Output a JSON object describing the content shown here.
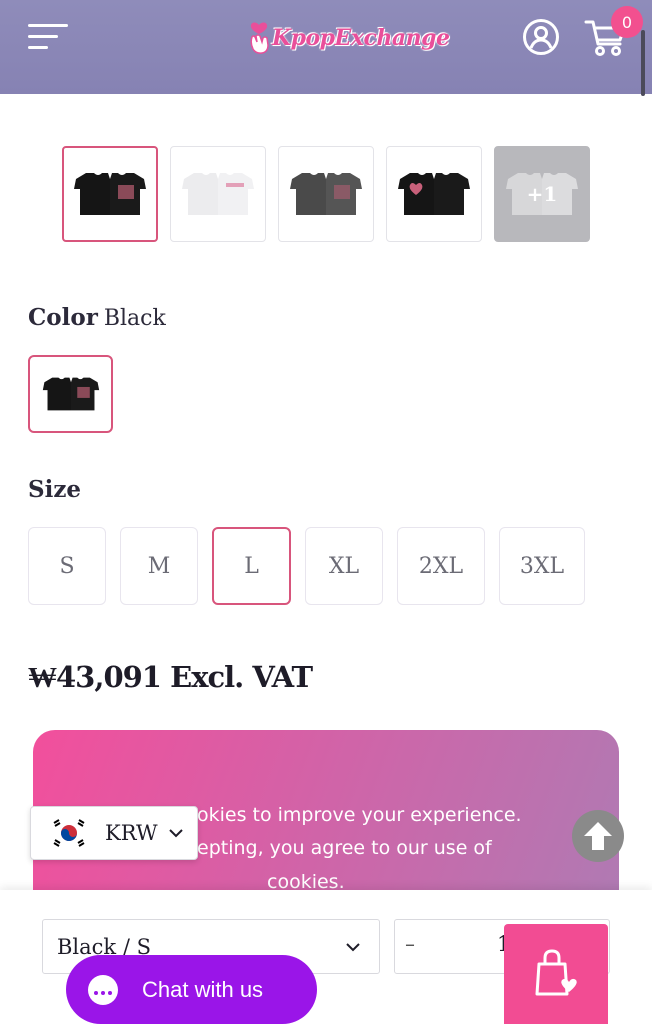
{
  "header": {
    "logo_text": "KpopExchange",
    "cart_count": "0"
  },
  "thumbnails": [
    {
      "name": "black-tee",
      "active": true
    },
    {
      "name": "white-tee",
      "active": false
    },
    {
      "name": "grey-tee",
      "active": false
    },
    {
      "name": "black-heart-tee",
      "active": false
    },
    {
      "name": "more-images",
      "active": false,
      "overlay": "+1"
    }
  ],
  "product": {
    "color_label": "Color",
    "color_value": "Black",
    "size_label": "Size",
    "sizes": [
      "S",
      "M",
      "L",
      "XL",
      "2XL",
      "3XL"
    ],
    "selected_size": "L",
    "price": "₩43,091 Excl. VAT"
  },
  "cookie": {
    "line1": "okies to improve your experience.",
    "line2": "epting, you agree to our use of",
    "line3": "cookies."
  },
  "currency": {
    "code": "KRW"
  },
  "bottom_bar": {
    "variant": "Black / S",
    "qty_minus": "–",
    "qty_value": "1"
  },
  "chat": {
    "label": "Chat with us"
  },
  "colors": {
    "header": "#8a86b6",
    "accent_pink": "#f24c93",
    "chat_purple": "#9a15e8"
  }
}
